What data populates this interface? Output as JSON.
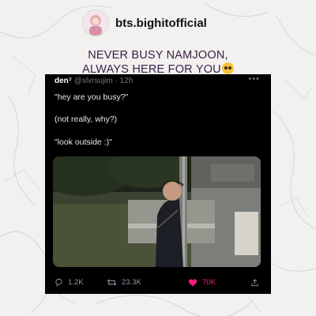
{
  "header": {
    "handle": "bts.bighitofficial"
  },
  "caption": {
    "line1": "NEVER BUSY NAMJOON,",
    "line2": "ALWAYS HERE FOR YOU"
  },
  "tweet": {
    "display_name": "den⁷",
    "username": "@slvrsujim",
    "separator": " · ",
    "time": "12h",
    "more": "•••",
    "lines": [
      "\"hey are you busy?\"",
      "(not really, why?)",
      "\"look outside :)\""
    ],
    "reply_count": "1.2K",
    "retweet_count": "23.3K",
    "like_count": "70K"
  },
  "icons": {
    "reply": "reply-icon",
    "retweet": "retweet-icon",
    "like": "heart-icon",
    "share": "share-icon",
    "emoji": "pleading-face-emoji-icon"
  },
  "colors": {
    "caption": "#3a2147",
    "like": "#f91880",
    "tweet_bg": "#000000"
  }
}
